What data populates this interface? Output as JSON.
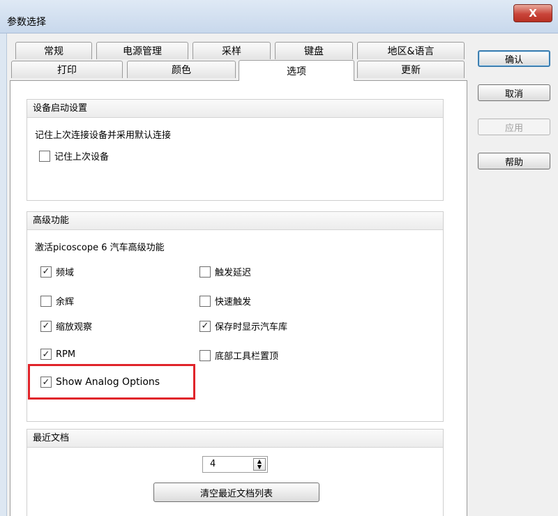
{
  "window": {
    "title": "参数选择",
    "close_label": "X"
  },
  "tabs_row1": [
    "常规",
    "电源管理",
    "采样",
    "键盘",
    "地区&语言"
  ],
  "tabs_row2": [
    "打印",
    "颜色",
    "选项",
    "更新"
  ],
  "active_tab": "选项",
  "side_buttons": {
    "ok": "确认",
    "cancel": "取消",
    "apply": "应用",
    "help": "帮助"
  },
  "device_startup": {
    "header": "设备启动设置",
    "description": "记住上次连接设备并采用默认连接",
    "remember_last_device": {
      "label": "记住上次设备",
      "checked": false
    }
  },
  "advanced": {
    "header": "高级功能",
    "description": "激活picoscope 6 汽车高级功能",
    "options_left": [
      {
        "label": "频域",
        "checked": true
      },
      {
        "label": "余辉",
        "checked": false
      },
      {
        "label": "缩放观察",
        "checked": true
      },
      {
        "label": "RPM",
        "checked": true
      },
      {
        "label": "Show Analog Options",
        "checked": true
      }
    ],
    "options_right": [
      {
        "label": "触发延迟",
        "checked": false
      },
      {
        "label": "快速触发",
        "checked": false
      },
      {
        "label": "保存时显示汽车库",
        "checked": true
      },
      {
        "label": "底部工具栏置顶",
        "checked": false
      }
    ]
  },
  "recent_docs": {
    "header": "最近文档",
    "count_value": "4",
    "clear_label": "清空最近文档列表"
  },
  "colors": {
    "highlight": "#e0242a",
    "default_button_border": "#3c7fb1"
  }
}
